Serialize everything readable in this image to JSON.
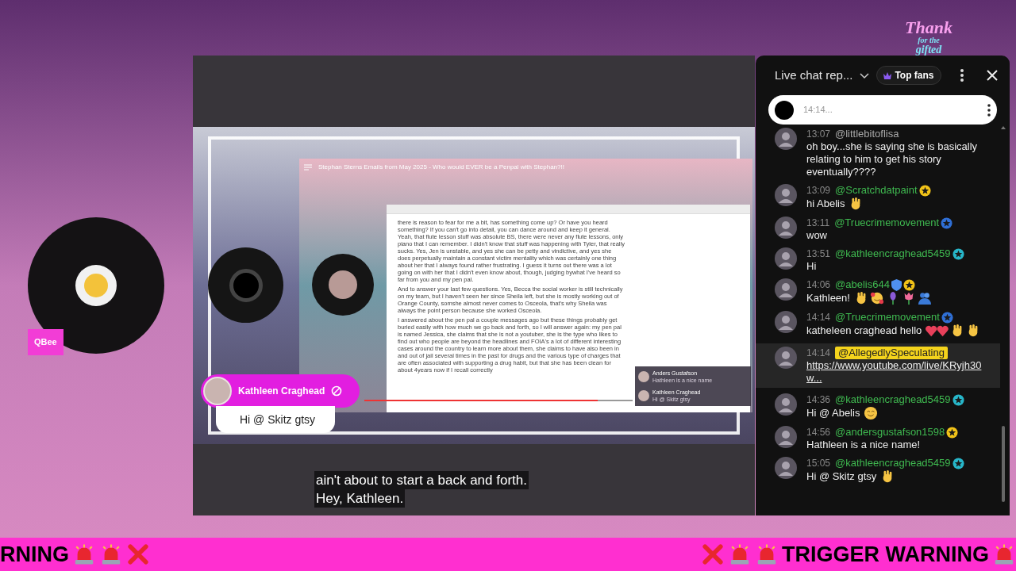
{
  "stream_badge": {
    "label": "QBee"
  },
  "thanks_art": {
    "line_1": "Thank",
    "line_2": "for the",
    "line_3": "gifted"
  },
  "video": {
    "title": "Stephan Sterns Emails from May 2025 - Who would EVER be a Penpal with Stephan?!!",
    "document_paragraphs": [
      "there is reason to fear for me a bit, has something come up? Or have you heard something? If you can't go into detail, you can dance around and keep it general. Yeah, that flute lesson stuff was absolute BS, there were never any flute lessons, only piano that I can remember. I didn't know that stuff was happening with Tyler, that really sucks. Yes, Jen is unstable, and yes she can be petty and vindictive, and yes she does perpetually maintain a constant victim mentality which was certainly one thing about her that I always found rather frustrating. I guess it turns out there was a lot going on with her that I didn't even know about, though, judging bywhat I've heard so far from you and my pen pal.",
      "And to answer your last few questions. Yes, Becca the social worker is still technically on my team, but I haven't seen her since Sheila left, but she is mostly working out of Orange County, somshe almost never comes to Osceola, that's why Sheila was always the point person because she worked Osceola.",
      "I answered about the pen pal a couple messages ago but these things probably get buried easily with how much we go back and forth, so I will answer again: my pen pal is named Jessica, she claims that she is not a youtuber, she is the type who likes to find out who people are beyond the headlines and FOIA's a lot of different interesting cases around the country to learn more about them, she claims to have also been in and out of jail several times in the past for drugs and the various type of charges that are often associated with supporting a drug habit, but that she has been clean for about 4years now if I recall correctly"
    ],
    "overlay_chat": [
      {
        "name": "Anders Gustafson",
        "text": "Hathleen is a nice name"
      },
      {
        "name": "Kathleen Craghead",
        "text": "Hi @ Skitz gtsy"
      }
    ],
    "progress": {
      "level": 0.87
    },
    "captions": [
      "ain't about to start a back and forth.",
      "Hey, Kathleen."
    ]
  },
  "featured_comment": {
    "name": "Kathleen Craghead",
    "text": "Hi @ Skitz gtsy"
  },
  "chat": {
    "title": "Live chat rep...",
    "filter": "Top fans",
    "pinned": {
      "text": "14:14..."
    },
    "messages": [
      {
        "time": "13:07",
        "author": "@littlebitoflisa",
        "member": false,
        "highlighted": false,
        "link": false,
        "text": "oh boy...she is saying she is basically relating to him to get his story eventually????"
      },
      {
        "time": "13:09",
        "author": "@Scratchdatpaint",
        "member": true,
        "highlighted": false,
        "link": false,
        "badges": [
          {
            "kind": "star",
            "color": "#f2c318"
          }
        ],
        "text": "hi Abelis",
        "emojis": [
          {
            "kind": "wave"
          }
        ]
      },
      {
        "time": "13:11",
        "author": "@Truecrimemovement",
        "member": true,
        "highlighted": false,
        "link": false,
        "badges": [
          {
            "kind": "star",
            "color": "#2f6fd6"
          }
        ],
        "text": "wow"
      },
      {
        "time": "13:51",
        "author": "@kathleencraghead5459",
        "member": true,
        "highlighted": false,
        "link": false,
        "badges": [
          {
            "kind": "star",
            "color": "#27b6c9"
          }
        ],
        "text": "Hi"
      },
      {
        "time": "14:06",
        "author": "@abelis644",
        "member": true,
        "highlighted": false,
        "link": false,
        "badges": [
          {
            "kind": "shield",
            "color": "#4f8ff0"
          },
          {
            "kind": "star",
            "color": "#f2c318"
          }
        ],
        "text": "Kathleen!",
        "emojis": [
          {
            "kind": "wave"
          },
          {
            "kind": "heart-face"
          },
          {
            "kind": "flower"
          },
          {
            "kind": "tulip"
          },
          {
            "kind": "hug"
          }
        ]
      },
      {
        "time": "14:14",
        "author": "@Truecrimemovement",
        "member": true,
        "highlighted": false,
        "link": false,
        "badges": [
          {
            "kind": "star",
            "color": "#2f6fd6"
          }
        ],
        "text": "katheleen craghead hello",
        "emojis": [
          {
            "kind": "hearts"
          },
          {
            "kind": "wave"
          },
          {
            "kind": "wave"
          }
        ]
      },
      {
        "time": "14:14",
        "author": "@AllegedlySpeculating",
        "highlighted": true,
        "link": true,
        "text": "https://www.youtube.com/live/KRyjh30w..."
      },
      {
        "time": "14:36",
        "author": "@kathleencraghead5459",
        "member": true,
        "highlighted": false,
        "link": false,
        "badges": [
          {
            "kind": "star",
            "color": "#27b6c9"
          }
        ],
        "text": "Hi @ Abelis",
        "emojis": [
          {
            "kind": "smile"
          }
        ]
      },
      {
        "time": "14:56",
        "author": "@andersgustafson1598",
        "member": true,
        "highlighted": false,
        "link": false,
        "badges": [
          {
            "kind": "star",
            "color": "#f2c318"
          }
        ],
        "text": "Hathleen is a nice name!"
      },
      {
        "time": "15:05",
        "author": "@kathleencraghead5459",
        "member": true,
        "highlighted": false,
        "link": false,
        "badges": [
          {
            "kind": "star",
            "color": "#27b6c9"
          }
        ],
        "text": "Hi @ Skitz gtsy",
        "emojis": [
          {
            "kind": "wave"
          }
        ]
      }
    ]
  },
  "ticker": {
    "left": [
      {
        "kind": "text",
        "text": "RNING"
      },
      {
        "kind": "siren"
      },
      {
        "kind": "siren"
      },
      {
        "kind": "cross"
      }
    ],
    "right": [
      {
        "kind": "cross"
      },
      {
        "kind": "siren"
      },
      {
        "kind": "siren"
      },
      {
        "kind": "text",
        "text": "TRIGGER WARNING"
      },
      {
        "kind": "siren"
      }
    ]
  }
}
